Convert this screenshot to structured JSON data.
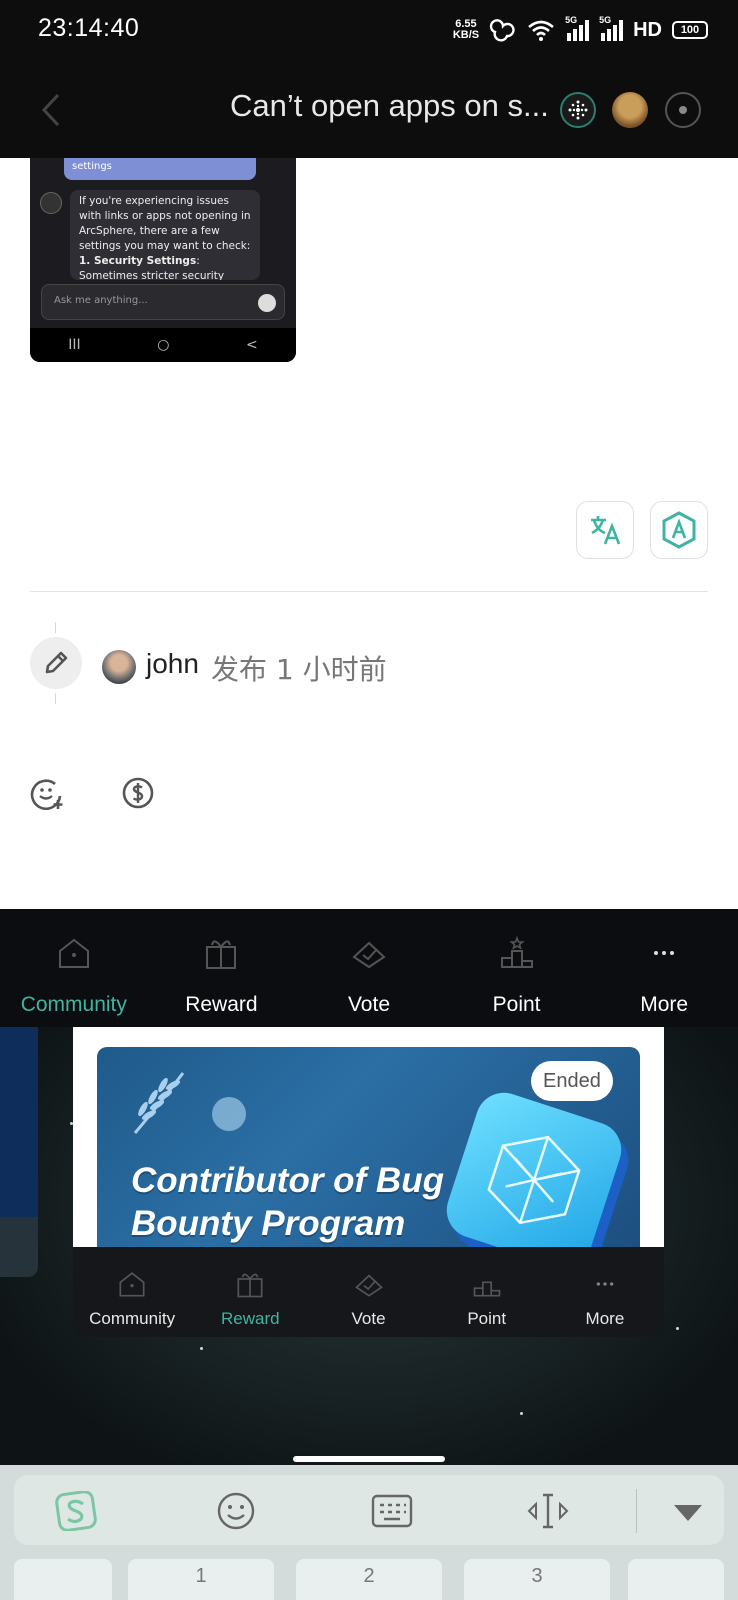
{
  "status_bar": {
    "time": "23:14:40",
    "net_speed_value": "6.55",
    "net_speed_unit": "KB/S",
    "sim1_label": "5G",
    "sim2_label": "5G",
    "hd_label": "HD",
    "battery": "100"
  },
  "app_bar": {
    "title": "Can’t open apps on s..."
  },
  "embedded_screenshot": {
    "user_bubble": "settings",
    "bot_text": "If you're experiencing issues with links or apps not opening in ArcSphere, there are a few settings you may want to check:",
    "bot_item_bold": "1. Security Settings",
    "bot_item_rest": ": Sometimes stricter security settings can",
    "input_placeholder": "Ask me anything...",
    "nav_recent": "III",
    "nav_home": "○",
    "nav_back": "<"
  },
  "post_meta": {
    "author": "john",
    "time_text": "发布 1 小时前"
  },
  "tabbar": {
    "tabs": [
      {
        "label": "Community",
        "icon": "home-icon"
      },
      {
        "label": "Reward",
        "icon": "gift-icon"
      },
      {
        "label": "Vote",
        "icon": "vote-icon"
      },
      {
        "label": "Point",
        "icon": "podium-icon"
      },
      {
        "label": "More",
        "icon": "more-icon"
      }
    ],
    "active_index": 0,
    "active_color": "#3fb4a0"
  },
  "popup": {
    "badge": "Ended",
    "banner_title_line1": "Contributor of Bug",
    "banner_title_line2": "Bounty Program",
    "tabs": [
      {
        "label": "Community"
      },
      {
        "label": "Reward"
      },
      {
        "label": "Vote"
      },
      {
        "label": "Point"
      },
      {
        "label": "More"
      }
    ],
    "active_index": 1
  },
  "keyboard": {
    "key_1": "1",
    "key_2": "2",
    "key_3": "3"
  }
}
